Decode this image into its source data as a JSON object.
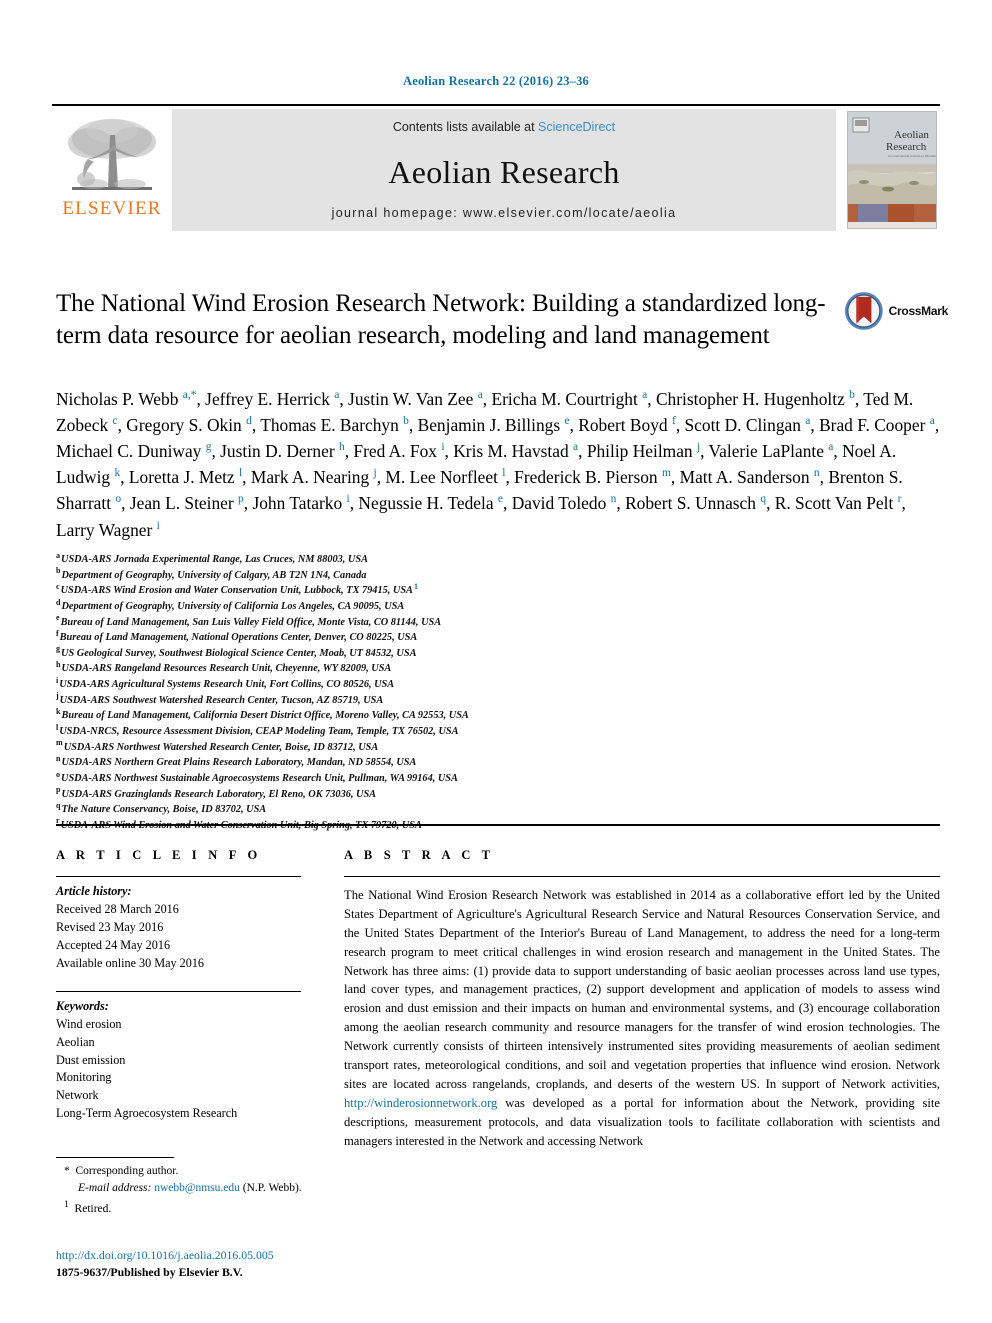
{
  "running_head": "Aeolian Research 22 (2016) 23–36",
  "masthead": {
    "contents_prefix": "Contents lists available at ",
    "sciencedirect": "ScienceDirect",
    "journal_title": "Aeolian Research",
    "homepage": "journal homepage: www.elsevier.com/locate/aeolia",
    "publisher_logo_text": "ELSEVIER",
    "cover_title_line1": "Aeolian",
    "cover_title_line2": "Research"
  },
  "title": "The National Wind Erosion Research Network: Building a standardized long-term data resource for aeolian research, modeling and land management",
  "crossmark_label": "CrossMark",
  "authors_html": "Nicholas P. Webb <sup class=\"star\">a,*</sup>, Jeffrey E. Herrick <sup>a</sup>, Justin W. Van Zee <sup>a</sup>, Ericha M. Courtright <sup>a</sup>, Christopher H. Hugenholtz <sup>b</sup>, Ted M. Zobeck <sup>c</sup>, Gregory S. Okin <sup>d</sup>, Thomas E. Barchyn <sup>b</sup>, Benjamin J. Billings <sup>e</sup>, Robert Boyd <sup>f</sup>, Scott D. Clingan <sup>a</sup>, Brad F. Cooper <sup>a</sup>, Michael C. Duniway <sup>g</sup>, Justin D. Derner <sup>h</sup>, Fred A. Fox <sup>i</sup>, Kris M. Havstad <sup>a</sup>, Philip Heilman <sup>j</sup>, Valerie LaPlante <sup>a</sup>, Noel A. Ludwig <sup>k</sup>, Loretta J. Metz <sup>l</sup>, Mark A. Nearing <sup>j</sup>, M. Lee Norfleet <sup>l</sup>, Frederick B. Pierson <sup>m</sup>, Matt A. Sanderson <sup>n</sup>, Brenton S. Sharratt <sup>o</sup>, Jean L. Steiner <sup>p</sup>, John Tatarko <sup>i</sup>, Negussie H. Tedela <sup>e</sup>, David Toledo <sup>n</sup>, Robert S. Unnasch <sup>q</sup>, R. Scott Van Pelt <sup>r</sup>, Larry Wagner <sup>i</sup>",
  "affiliations": [
    {
      "mark": "a",
      "text": "USDA-ARS Jornada Experimental Range, Las Cruces, NM 88003, USA",
      "note": ""
    },
    {
      "mark": "b",
      "text": "Department of Geography, University of Calgary, AB T2N 1N4, Canada",
      "note": ""
    },
    {
      "mark": "c",
      "text": "USDA-ARS Wind Erosion and Water Conservation Unit, Lubbock, TX 79415, USA",
      "note": "1"
    },
    {
      "mark": "d",
      "text": "Department of Geography, University of California Los Angeles, CA 90095, USA",
      "note": ""
    },
    {
      "mark": "e",
      "text": "Bureau of Land Management, San Luis Valley Field Office, Monte Vista, CO 81144, USA",
      "note": ""
    },
    {
      "mark": "f",
      "text": "Bureau of Land Management, National Operations Center, Denver, CO 80225, USA",
      "note": ""
    },
    {
      "mark": "g",
      "text": "US Geological Survey, Southwest Biological Science Center, Moab, UT 84532, USA",
      "note": ""
    },
    {
      "mark": "h",
      "text": "USDA-ARS Rangeland Resources Research Unit, Cheyenne, WY 82009, USA",
      "note": ""
    },
    {
      "mark": "i",
      "text": "USDA-ARS Agricultural Systems Research Unit, Fort Collins, CO 80526, USA",
      "note": ""
    },
    {
      "mark": "j",
      "text": "USDA-ARS Southwest Watershed Research Center, Tucson, AZ 85719, USA",
      "note": ""
    },
    {
      "mark": "k",
      "text": "Bureau of Land Management, California Desert District Office, Moreno Valley, CA 92553, USA",
      "note": ""
    },
    {
      "mark": "l",
      "text": "USDA-NRCS, Resource Assessment Division, CEAP Modeling Team, Temple, TX 76502, USA",
      "note": ""
    },
    {
      "mark": "m",
      "text": "USDA-ARS Northwest Watershed Research Center, Boise, ID 83712, USA",
      "note": ""
    },
    {
      "mark": "n",
      "text": "USDA-ARS Northern Great Plains Research Laboratory, Mandan, ND 58554, USA",
      "note": ""
    },
    {
      "mark": "o",
      "text": "USDA-ARS Northwest Sustainable Agroecosystems Research Unit, Pullman, WA 99164, USA",
      "note": ""
    },
    {
      "mark": "p",
      "text": "USDA-ARS Grazinglands Research Laboratory, El Reno, OK 73036, USA",
      "note": ""
    },
    {
      "mark": "q",
      "text": "The Nature Conservancy, Boise, ID 83702, USA",
      "note": ""
    },
    {
      "mark": "r",
      "text": "USDA-ARS Wind Erosion and Water Conservation Unit, Big Spring, TX 79720, USA",
      "note": ""
    }
  ],
  "article_info": {
    "heading": "A R T I C L E   I N F O",
    "history_label": "Article history:",
    "history": [
      "Received 28 March 2016",
      "Revised 23 May 2016",
      "Accepted 24 May 2016",
      "Available online 30 May 2016"
    ],
    "keywords_label": "Keywords:",
    "keywords": [
      "Wind erosion",
      "Aeolian",
      "Dust emission",
      "Monitoring",
      "Network",
      "Long-Term Agroecosystem Research"
    ]
  },
  "abstract": {
    "heading": "A B S T R A C T",
    "part1": "The National Wind Erosion Research Network was established in 2014 as a collaborative effort led by the United States Department of Agriculture's Agricultural Research Service and Natural Resources Conservation Service, and the United States Department of the Interior's Bureau of Land Management, to address the need for a long-term research program to meet critical challenges in wind erosion research and management in the United States. The Network has three aims: (1) provide data to support understanding of basic aeolian processes across land use types, land cover types, and management practices, (2) support development and application of models to assess wind erosion and dust emission and their impacts on human and environmental systems, and (3) encourage collaboration among the aeolian research community and resource managers for the transfer of wind erosion technologies. The Network currently consists of thirteen intensively instrumented sites providing measurements of aeolian sediment transport rates, meteorological conditions, and soil and vegetation properties that influence wind erosion. Network sites are located across rangelands, croplands, and deserts of the western US. In support of Network activities, ",
    "link": "http://winderosionnetwork.org",
    "part2": " was developed as a portal for information about the Network, providing site descriptions, measurement protocols, and data visualization tools to facilitate collaboration with scientists and managers interested in the Network and accessing Network"
  },
  "footnotes": {
    "corresponding": "Corresponding author.",
    "email_label": "E-mail address:",
    "email": "nwebb@nmsu.edu",
    "email_suffix": "(N.P. Webb).",
    "retired_mark": "1",
    "retired": "Retired."
  },
  "footer": {
    "doi": "http://dx.doi.org/10.1016/j.aeolia.2016.05.005",
    "issn_line": "1875-9637/Published by Elsevier B.V."
  },
  "colors": {
    "link_blue": "#1073a8",
    "sciencedirect_blue": "#3b8ed0",
    "elsevier_orange": "#E87722",
    "masthead_gray": "#e3e3e3"
  }
}
